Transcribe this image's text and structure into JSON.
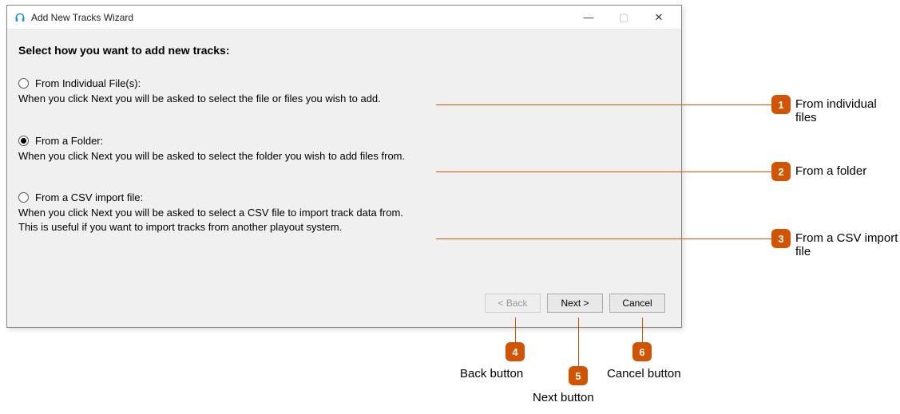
{
  "window": {
    "title": "Add New Tracks Wizard",
    "controls": {
      "minimize": "—",
      "maximize": "▢",
      "close": "✕"
    }
  },
  "heading": "Select how you want to add new tracks:",
  "options": [
    {
      "label": "From Individual File(s):",
      "desc": "When you click Next you will be asked to select the file or files you wish to add.",
      "selected": false
    },
    {
      "label": "From a Folder:",
      "desc": "When you click Next you will be asked to select the folder you wish to add files from.",
      "selected": true
    },
    {
      "label": "From a CSV import file:",
      "desc": "When you click Next you will be asked to select a CSV file to import track data from.\nThis is useful if you want to import tracks from another playout system.",
      "selected": false
    }
  ],
  "buttons": {
    "back": "< Back",
    "next": "Next >",
    "cancel": "Cancel"
  },
  "callouts": [
    {
      "num": "1",
      "text": "From individual files"
    },
    {
      "num": "2",
      "text": "From a folder"
    },
    {
      "num": "3",
      "text": "From a CSV import file"
    },
    {
      "num": "4",
      "text": "Back button"
    },
    {
      "num": "5",
      "text": "Next button"
    },
    {
      "num": "6",
      "text": "Cancel button"
    }
  ]
}
